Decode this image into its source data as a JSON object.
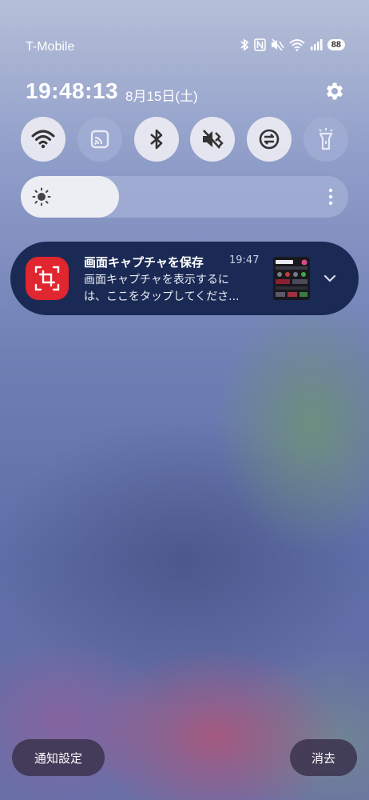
{
  "status_bar": {
    "carrier": "T-Mobile",
    "battery": "88",
    "icons": [
      "bluetooth-icon",
      "nfc-icon",
      "mute-icon",
      "wifi-icon",
      "signal-icon",
      "battery-icon"
    ]
  },
  "header": {
    "time": "19:48:13",
    "date": "8月15日(土)",
    "settings_icon": "gear-icon"
  },
  "quick_tiles": [
    {
      "icon": "wifi-icon",
      "state": "on"
    },
    {
      "icon": "cast-icon",
      "state": "off"
    },
    {
      "icon": "bluetooth-icon",
      "state": "on"
    },
    {
      "icon": "mute-icon",
      "state": "on"
    },
    {
      "icon": "sync-icon",
      "state": "on"
    },
    {
      "icon": "flashlight-icon",
      "state": "off"
    }
  ],
  "brightness": {
    "level": 0.3,
    "icon": "sun-icon",
    "more_icon": "more-vertical-icon"
  },
  "notification": {
    "app_icon": "screenshot-icon",
    "title": "画面キャプチャを保存",
    "time": "19:47",
    "body_line1": "画面キャプチャを表示するに",
    "body_line2": "は、ここをタップしてくださ...",
    "expand_icon": "chevron-down-icon"
  },
  "buttons": {
    "notification_settings": "通知設定",
    "clear": "消去"
  },
  "colors": {
    "notification_bg": "#1b2a55",
    "app_icon_bg": "#e0262f",
    "tile_on": "#ebecf2",
    "tile_off": "#a5b0d6"
  }
}
